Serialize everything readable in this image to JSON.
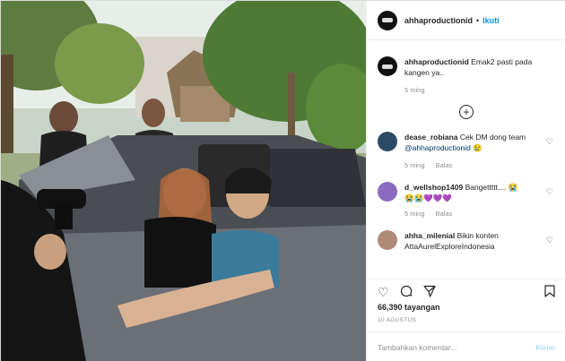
{
  "post": {
    "author": "ahhaproductionid",
    "follow_label": "Ikuti",
    "separator": "•"
  },
  "caption": {
    "author": "ahhaproductionid",
    "text": "Emak2 pasti pada kangen ya..",
    "time": "5 ming"
  },
  "load_more_icon": "plus-circle-icon",
  "comments": [
    {
      "user": "dease_robiana",
      "text": "Cek DM dong team ",
      "mention": "@ahhaproductionid",
      "emoji": "😢",
      "time": "5 ming",
      "reply": "Balas"
    },
    {
      "user": "d_wellshop1409",
      "text": "Bangettttt.... 😭",
      "emoji": "😭😭💜💜💜",
      "time": "5 ming",
      "reply": "Balas"
    },
    {
      "user": "ahha_milenial",
      "text": "Bikin konten AttaAurelExploreIndonesia",
      "time": "",
      "reply": ""
    }
  ],
  "actions": {
    "like_icon": "heart-icon",
    "comment_icon": "comment-icon",
    "share_icon": "share-icon",
    "save_icon": "bookmark-icon"
  },
  "views": "66,390 tayangan",
  "date": "10 AGUSTUS",
  "add_comment": {
    "placeholder": "Tambahkan komentar...",
    "post_label": "Kirim"
  },
  "colors": {
    "accent": "#0095f6",
    "muted": "#8e8e8e"
  }
}
